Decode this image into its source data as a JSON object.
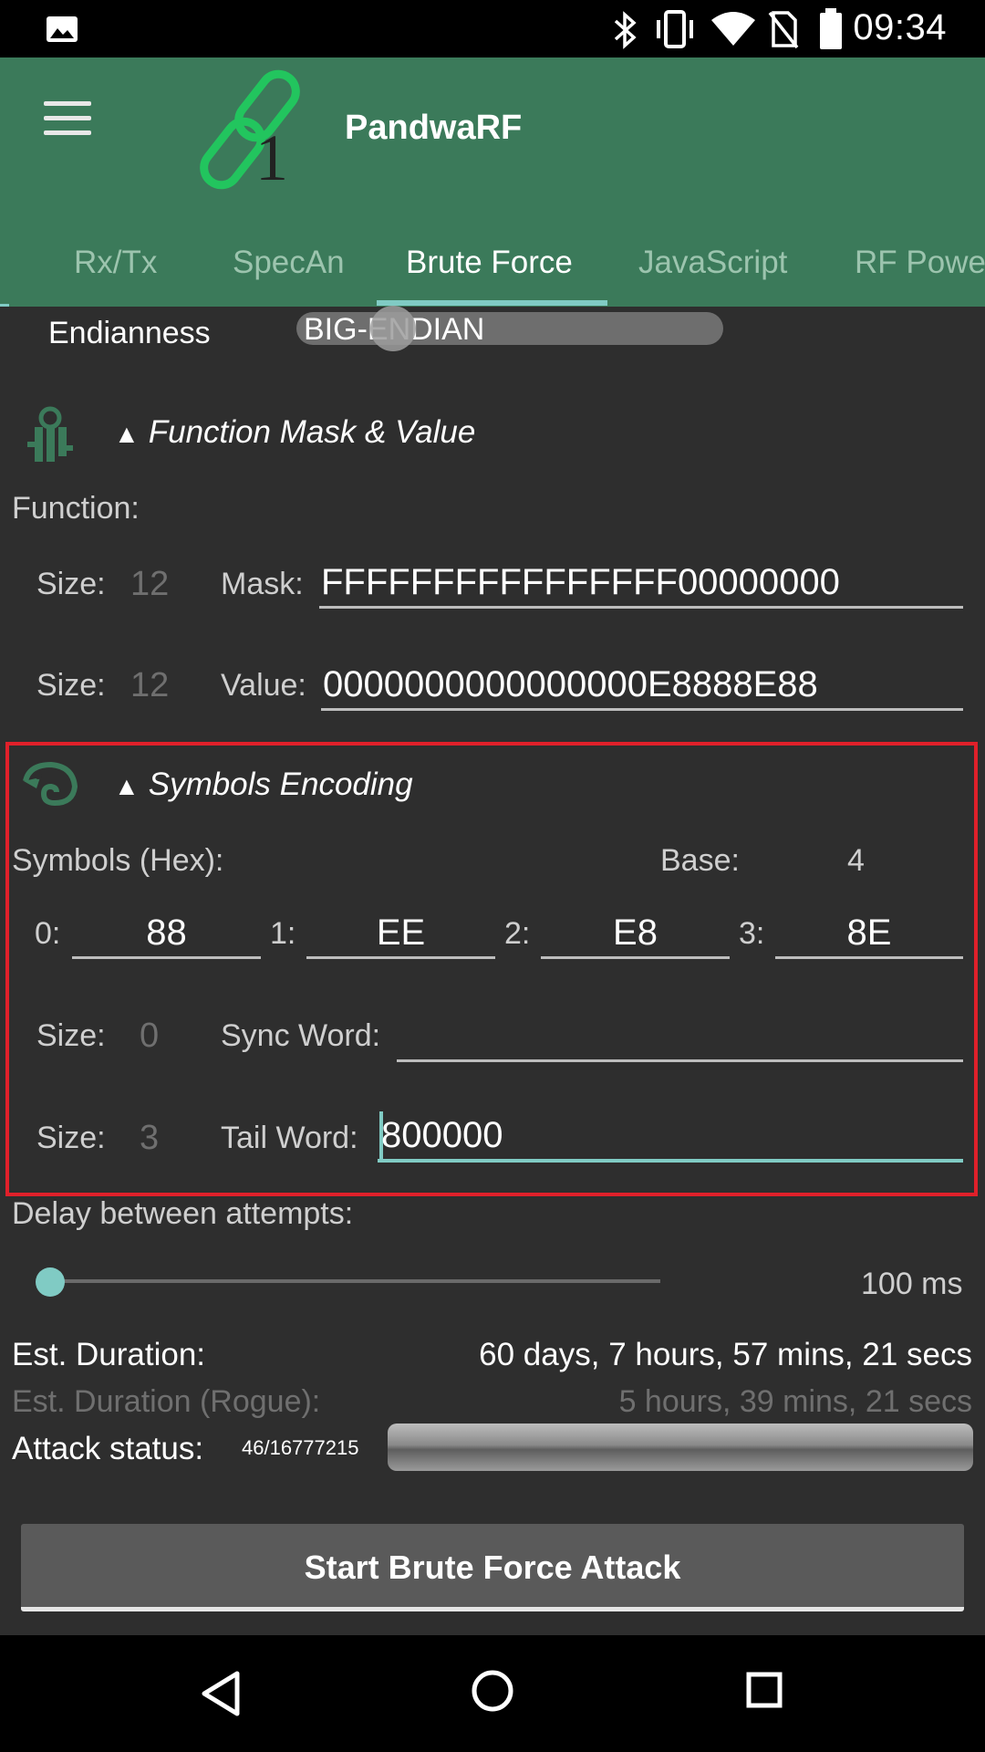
{
  "status_bar": {
    "time": "09:34",
    "icons": [
      "image-icon",
      "bluetooth-icon",
      "vibrate-icon",
      "wifi-icon",
      "no-sim-icon",
      "battery-icon"
    ]
  },
  "app_bar": {
    "title": "PandwaRF",
    "logo_icon": "chain-link-logo",
    "logo_digit": "1",
    "menu_icon": "hamburger-menu-icon",
    "colors": {
      "background": "#3b7a5a",
      "accent": "#80cbc4"
    }
  },
  "tabs": [
    {
      "label": "Rx/Tx"
    },
    {
      "label": "SpecAn"
    },
    {
      "label": "Brute Force",
      "active": true
    },
    {
      "label": "JavaScript"
    },
    {
      "label": "RF Powe"
    }
  ],
  "endianness": {
    "label": "Endianness",
    "value": "BIG-ENDIAN"
  },
  "function_section": {
    "header": "Function Mask & Value",
    "icon": "keys-icon",
    "function_label": "Function:",
    "mask": {
      "size_label": "Size:",
      "size_value": "12",
      "label": "Mask:",
      "value": "FFFFFFFFFFFFFFFF00000000"
    },
    "value": {
      "size_label": "Size:",
      "size_value": "12",
      "label": "Value:",
      "value": "0000000000000000E8888E88"
    }
  },
  "symbols_section": {
    "header": "Symbols Encoding",
    "icon": "chameleon-icon",
    "symbols_label": "Symbols (Hex):",
    "base_label": "Base:",
    "base_value": "4",
    "symbols": [
      {
        "index": "0:",
        "value": "88"
      },
      {
        "index": "1:",
        "value": "EE"
      },
      {
        "index": "2:",
        "value": "E8"
      },
      {
        "index": "3:",
        "value": "8E"
      }
    ],
    "sync": {
      "size_label": "Size:",
      "size_value": "0",
      "label": "Sync Word:",
      "value": ""
    },
    "tail": {
      "size_label": "Size:",
      "size_value": "3",
      "label": "Tail Word:",
      "value": "800000"
    }
  },
  "delay": {
    "label": "Delay between attempts:",
    "value_text": "100 ms",
    "slider_fraction": 0.0
  },
  "duration": {
    "label": "Est. Duration:",
    "value": "60 days, 7 hours, 57 mins, 21 secs",
    "rogue_label": "Est. Duration (Rogue):",
    "rogue_value": "5 hours, 39 mins, 21 secs"
  },
  "attack": {
    "label": "Attack status:",
    "progress_text": "46/16777215"
  },
  "start_button": {
    "label": "Start Brute Force Attack"
  },
  "nav_bar": {
    "icons": [
      "back-icon",
      "home-icon",
      "recents-icon"
    ]
  }
}
